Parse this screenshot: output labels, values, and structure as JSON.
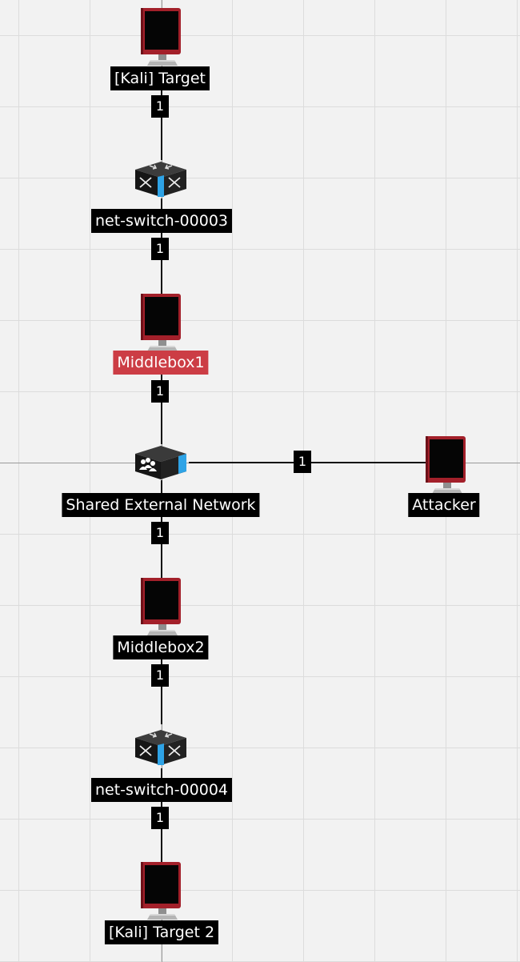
{
  "nodes": {
    "kali_target": {
      "label": "[Kali] Target",
      "icon": "monitor-icon"
    },
    "switch_00003": {
      "label": "net-switch-00003",
      "icon": "network-switch-icon"
    },
    "middlebox1": {
      "label": "Middlebox1",
      "icon": "monitor-icon",
      "selected": true
    },
    "shared_external": {
      "label": "Shared External Network",
      "icon": "external-network-icon"
    },
    "attacker": {
      "label": "Attacker",
      "icon": "monitor-icon"
    },
    "middlebox2": {
      "label": "Middlebox2",
      "icon": "monitor-icon"
    },
    "switch_00004": {
      "label": "net-switch-00004",
      "icon": "network-switch-icon"
    },
    "kali_target_2": {
      "label": "[Kali] Target 2",
      "icon": "monitor-icon"
    }
  },
  "links": {
    "l1": "1",
    "l2": "1",
    "l3": "1",
    "l4": "1",
    "l5": "1",
    "l6": "1",
    "l7": "1"
  },
  "colors": {
    "monitor_red": "#a3202a",
    "switch_blue": "#2ea3e6",
    "selected_label": "#cc3d45",
    "grid": "#dcdcdc",
    "background": "#f2f2f2"
  }
}
